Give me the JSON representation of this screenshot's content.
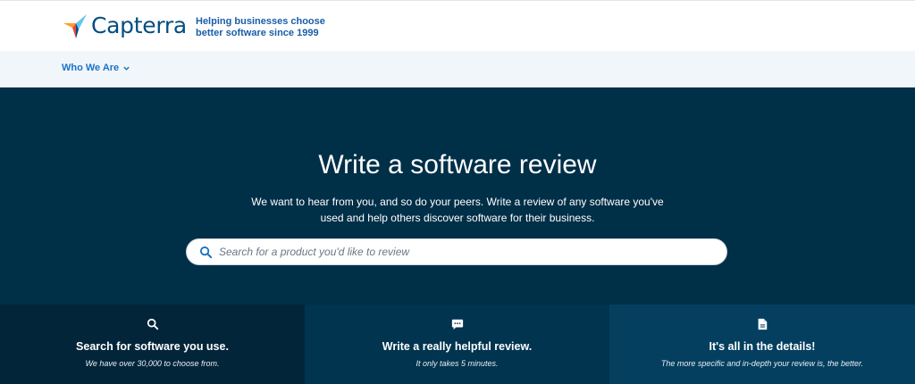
{
  "header": {
    "logo_text": "Capterra",
    "tagline_line1": "Helping businesses choose",
    "tagline_line2": "better software since 1999"
  },
  "nav": {
    "who_we_are": "Who We Are"
  },
  "hero": {
    "title": "Write a software review",
    "subtitle": "We want to hear from you, and so do your peers. Write a review of any software you've used and help others discover software for their business.",
    "search_placeholder": "Search for a product you'd like to review"
  },
  "features": [
    {
      "icon": "search-icon",
      "title": "Search for software you use.",
      "subtitle": "We have over 30,000 to choose from."
    },
    {
      "icon": "comment-icon",
      "title": "Write a really helpful review.",
      "subtitle": "It only takes 5 minutes."
    },
    {
      "icon": "document-icon",
      "title": "It's all in the details!",
      "subtitle": "The more specific and in-depth your review is, the better."
    }
  ],
  "colors": {
    "hero_bg": "#002f48",
    "brand_blue": "#044d80",
    "nav_link": "#1a73c9"
  }
}
